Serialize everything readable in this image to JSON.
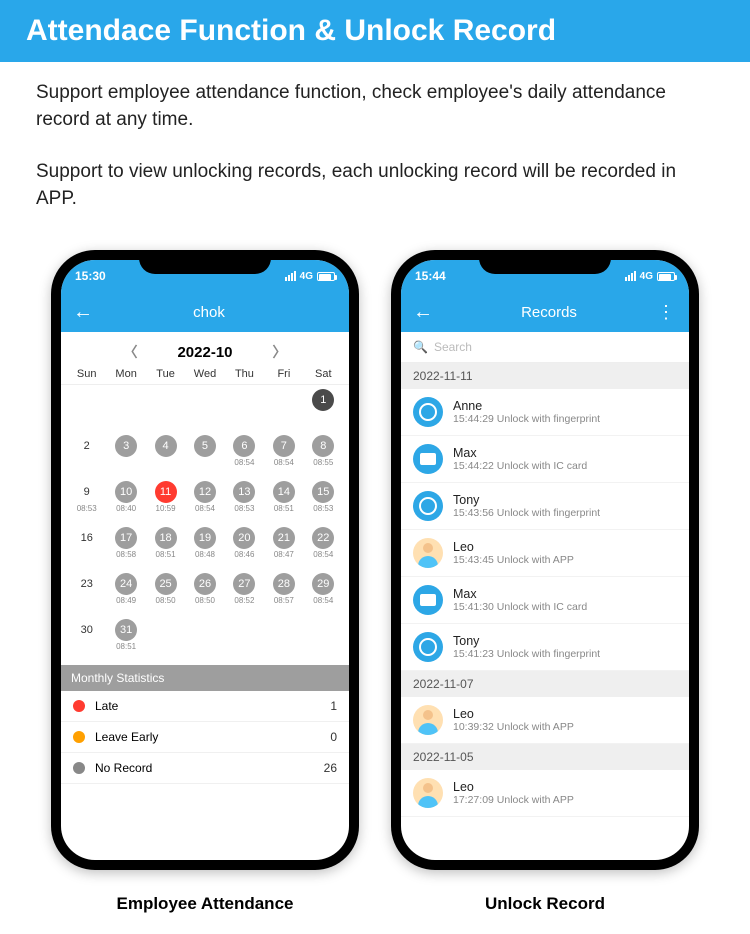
{
  "banner": "Attendace Function & Unlock Record",
  "desc1": "Support employee attendance function, check employee's daily attendance record at any time.",
  "desc2": "Support to view unlocking records, each unlocking record will be recorded in APP.",
  "phone1": {
    "time": "15:30",
    "net": "4G",
    "title": "chok",
    "month": "2022-10",
    "dow": [
      "Sun",
      "Mon",
      "Tue",
      "Wed",
      "Thu",
      "Fri",
      "Sat"
    ],
    "weeks": [
      [
        {
          "n": "",
          "s": ""
        },
        {
          "n": "",
          "s": ""
        },
        {
          "n": "",
          "s": ""
        },
        {
          "n": "",
          "s": ""
        },
        {
          "n": "",
          "s": ""
        },
        {
          "n": "",
          "s": ""
        },
        {
          "n": "1",
          "s": "",
          "c": "dark"
        }
      ],
      [
        {
          "n": "2",
          "s": ""
        },
        {
          "n": "3",
          "s": "",
          "c": "filled"
        },
        {
          "n": "4",
          "s": "",
          "c": "filled"
        },
        {
          "n": "5",
          "s": "",
          "c": "filled"
        },
        {
          "n": "6",
          "s": "08:54",
          "c": "filled"
        },
        {
          "n": "7",
          "s": "08:54",
          "c": "filled"
        },
        {
          "n": "8",
          "s": "08:55",
          "c": "filled"
        }
      ],
      [
        {
          "n": "9",
          "s": "08:53"
        },
        {
          "n": "10",
          "s": "08:40",
          "c": "filled"
        },
        {
          "n": "11",
          "s": "10:59",
          "c": "red"
        },
        {
          "n": "12",
          "s": "08:54",
          "c": "filled"
        },
        {
          "n": "13",
          "s": "08:53",
          "c": "filled"
        },
        {
          "n": "14",
          "s": "08:51",
          "c": "filled"
        },
        {
          "n": "15",
          "s": "08:53",
          "c": "filled"
        }
      ],
      [
        {
          "n": "16",
          "s": ""
        },
        {
          "n": "17",
          "s": "08:58",
          "c": "filled"
        },
        {
          "n": "18",
          "s": "08:51",
          "c": "filled"
        },
        {
          "n": "19",
          "s": "08:48",
          "c": "filled"
        },
        {
          "n": "20",
          "s": "08:46",
          "c": "filled"
        },
        {
          "n": "21",
          "s": "08:47",
          "c": "filled"
        },
        {
          "n": "22",
          "s": "08:54",
          "c": "filled"
        }
      ],
      [
        {
          "n": "23",
          "s": ""
        },
        {
          "n": "24",
          "s": "08:49",
          "c": "filled"
        },
        {
          "n": "25",
          "s": "08:50",
          "c": "filled"
        },
        {
          "n": "26",
          "s": "08:50",
          "c": "filled"
        },
        {
          "n": "27",
          "s": "08:52",
          "c": "filled"
        },
        {
          "n": "28",
          "s": "08:57",
          "c": "filled"
        },
        {
          "n": "29",
          "s": "08:54",
          "c": "filled"
        }
      ],
      [
        {
          "n": "30",
          "s": ""
        },
        {
          "n": "31",
          "s": "08:51",
          "c": "filled"
        },
        {
          "n": "",
          "s": ""
        },
        {
          "n": "",
          "s": ""
        },
        {
          "n": "",
          "s": ""
        },
        {
          "n": "",
          "s": ""
        },
        {
          "n": "",
          "s": ""
        }
      ]
    ],
    "stats_title": "Monthly Statistics",
    "stats": [
      {
        "label": "Late",
        "value": "1",
        "color": "red-dot"
      },
      {
        "label": "Leave Early",
        "value": "0",
        "color": "orange-dot"
      },
      {
        "label": "No Record",
        "value": "26",
        "color": "gray-dot"
      }
    ],
    "caption": "Employee Attendance"
  },
  "phone2": {
    "time": "15:44",
    "net": "4G",
    "title": "Records",
    "search": "Search",
    "sections": [
      {
        "date": "2022-11-11",
        "rows": [
          {
            "name": "Anne",
            "desc": "15:44:29 Unlock with fingerprint",
            "icon": "fp"
          },
          {
            "name": "Max",
            "desc": "15:44:22 Unlock with IC card",
            "icon": "card"
          },
          {
            "name": "Tony",
            "desc": "15:43:56 Unlock with fingerprint",
            "icon": "fp"
          },
          {
            "name": "Leo",
            "desc": "15:43:45 Unlock with APP",
            "icon": "avatar"
          },
          {
            "name": "Max",
            "desc": "15:41:30 Unlock with IC card",
            "icon": "card"
          },
          {
            "name": "Tony",
            "desc": "15:41:23 Unlock with fingerprint",
            "icon": "fp"
          }
        ]
      },
      {
        "date": "2022-11-07",
        "rows": [
          {
            "name": "Leo",
            "desc": "10:39:32 Unlock with APP",
            "icon": "avatar"
          }
        ]
      },
      {
        "date": "2022-11-05",
        "rows": [
          {
            "name": "Leo",
            "desc": "17:27:09 Unlock with APP",
            "icon": "avatar"
          }
        ]
      }
    ],
    "caption": "Unlock Record"
  }
}
